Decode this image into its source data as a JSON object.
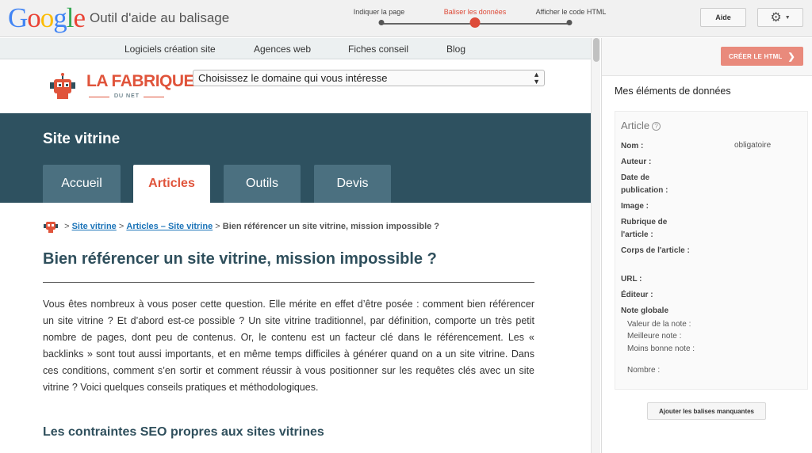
{
  "app": {
    "logo_letters": [
      "G",
      "o",
      "o",
      "g",
      "l",
      "e"
    ],
    "logo_colors": [
      "#4285f4",
      "#ea4335",
      "#fbbc05",
      "#4285f4",
      "#34a853",
      "#ea4335"
    ],
    "title": "Outil d'aide au balisage"
  },
  "steps": [
    {
      "label": "Indiquer la page",
      "active": false
    },
    {
      "label": "Baliser les données",
      "active": true
    },
    {
      "label": "Afficher le code HTML",
      "active": false
    }
  ],
  "toolbar": {
    "help_label": "Aide",
    "settings_icon": "gear-icon"
  },
  "site": {
    "nav": [
      "Logiciels création site",
      "Agences web",
      "Fiches conseil",
      "Blog"
    ],
    "logo_text": "LA FABRIQUE",
    "logo_sub": "DU NET",
    "domain_select": "Choisissez le domaine qui vous intéresse",
    "banner_title": "Site vitrine",
    "tabs": [
      {
        "label": "Accueil",
        "active": false
      },
      {
        "label": "Articles",
        "active": true
      },
      {
        "label": "Outils",
        "active": false
      },
      {
        "label": "Devis",
        "active": false
      }
    ],
    "breadcrumb": {
      "sep": ">",
      "link1": "Site vitrine",
      "link2": "Articles – Site vitrine",
      "current": "Bien référencer un site vitrine, mission impossible ?"
    },
    "heading": "Bien référencer un site vitrine, mission impossible ?",
    "paragraph": "Vous êtes nombreux à vous poser cette question. Elle mérite en effet d’être posée : comment bien référencer un site vitrine ? Et d’abord est-ce possible ? Un site vitrine traditionnel, par définition, comporte un très petit nombre de pages, dont peu de contenus. Or, le contenu est un facteur clé dans le référencement. Les « backlinks » sont tout aussi importants, et en même temps difficiles à générer quand on a un site vitrine. Dans ces conditions, comment s’en sortir et comment réussir à vous positionner sur les requêtes clés avec un site vitrine ? Voici quelques conseils pratiques et méthodologiques.",
    "subheading": "Les contraintes SEO propres aux sites vitrines"
  },
  "panel": {
    "create_button": "CRÉER LE HTML",
    "title": "Mes éléments de données",
    "card_title": "Article",
    "required_label": "obligatoire",
    "fields": {
      "nom": "Nom :",
      "auteur": "Auteur :",
      "date": "Date de publication :",
      "image": "Image :",
      "rubrique": "Rubrique de l'article :",
      "corps": "Corps de l'article :",
      "url": "URL :",
      "editeur": "Éditeur :",
      "note": "Note globale"
    },
    "subfields": {
      "valeur": "Valeur de la note :",
      "meilleure": "Meilleure note :",
      "moins_bonne": "Moins bonne note :",
      "nombre": "Nombre :"
    },
    "add_missing_button": "Ajouter les balises manquantes"
  }
}
